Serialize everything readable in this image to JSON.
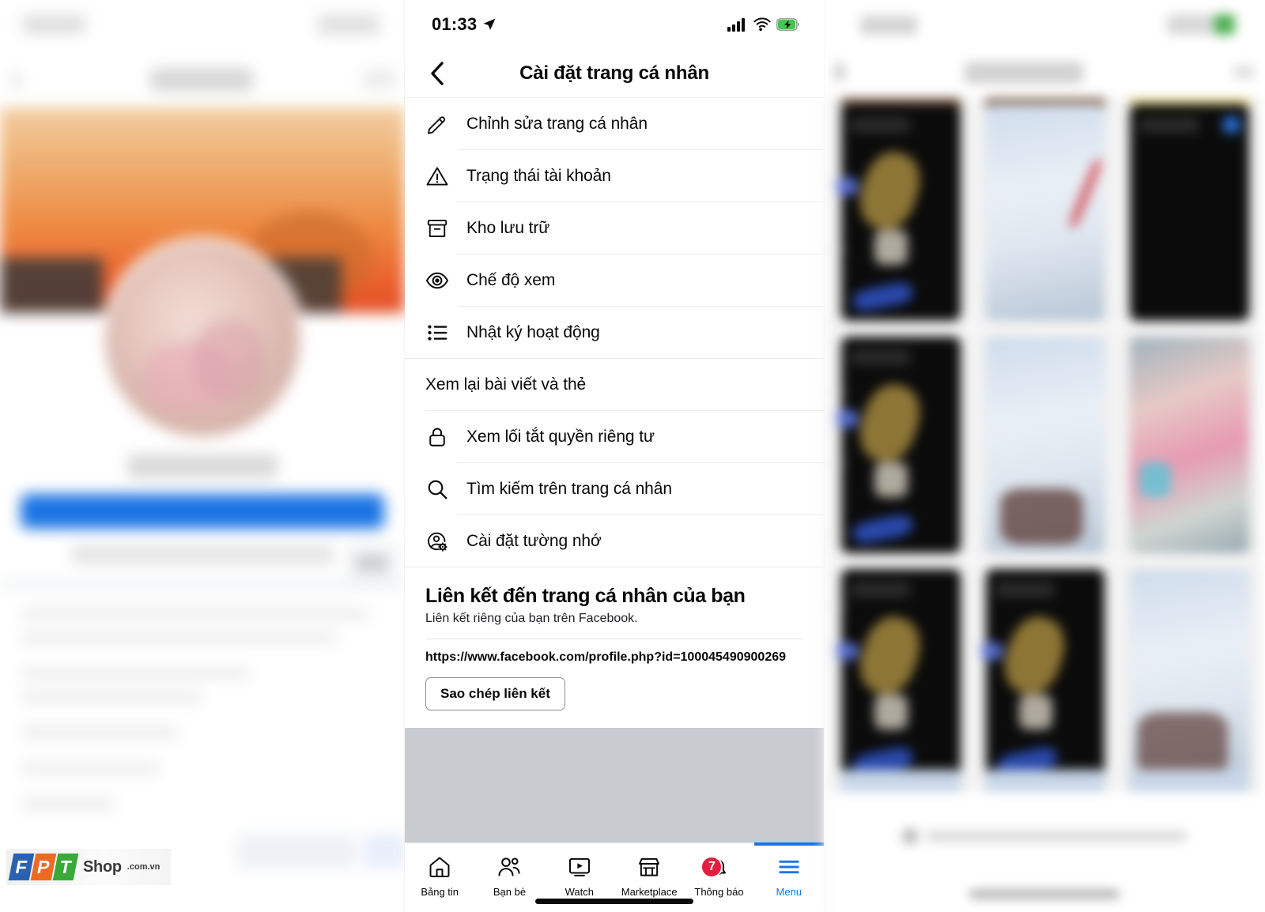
{
  "center": {
    "status_bar": {
      "time": "01:33",
      "location_icon": "location-arrow-icon",
      "signal_icon": "cellular-signal-icon",
      "wifi_icon": "wifi-icon",
      "battery_icon": "battery-charging-icon"
    },
    "nav": {
      "back_icon": "chevron-left-icon",
      "title": "Cài đặt trang cá nhân"
    },
    "menu_items": [
      {
        "label": "Chỉnh sửa trang cá nhân",
        "icon": "pencil-icon"
      },
      {
        "label": "Trạng thái tài khoản",
        "icon": "warning-triangle-icon"
      },
      {
        "label": "Kho lưu trữ",
        "icon": "archive-box-icon"
      },
      {
        "label": "Chế độ xem",
        "icon": "eye-icon"
      },
      {
        "label": "Nhật ký hoạt động",
        "icon": "bulleted-list-icon"
      },
      {
        "label": "Xem lại bài viết và thẻ",
        "icon": ""
      },
      {
        "label": "Xem lối tắt quyền riêng tư",
        "icon": "lock-icon"
      },
      {
        "label": "Tìm kiếm trên trang cá nhân",
        "icon": "search-icon"
      },
      {
        "label": "Cài đặt tường nhớ",
        "icon": "person-gear-icon"
      }
    ],
    "link_section": {
      "title": "Liên kết đến trang cá nhân của bạn",
      "subtitle": "Liên kết riêng của bạn trên Facebook.",
      "url": "https://www.facebook.com/profile.php?id=100045490900269",
      "copy_button": "Sao chép liên kết"
    },
    "tabs": [
      {
        "label": "Bảng tin",
        "icon": "home-icon",
        "active": false,
        "badge": ""
      },
      {
        "label": "Bạn bè",
        "icon": "friends-icon",
        "active": false,
        "badge": ""
      },
      {
        "label": "Watch",
        "icon": "watch-play-icon",
        "active": false,
        "badge": ""
      },
      {
        "label": "Marketplace",
        "icon": "marketplace-store-icon",
        "active": false,
        "badge": ""
      },
      {
        "label": "Thông báo",
        "icon": "bell-icon",
        "active": false,
        "badge": "7"
      },
      {
        "label": "Menu",
        "icon": "hamburger-menu-icon",
        "active": true,
        "badge": ""
      }
    ],
    "colors": {
      "accent": "#1b74e4",
      "badge": "#e41e3f",
      "text": "#080809",
      "divider": "#eaecef",
      "placeholder_block": "#c8cbd0"
    }
  },
  "left": {
    "watermark": {
      "mark_f": "F",
      "mark_p": "P",
      "mark_t": "T",
      "shop": "Shop",
      "domain": ".com.vn"
    },
    "more_button_icon": "ellipsis-icon",
    "primary_button_color": "#1b74e4",
    "cover_color": "#ee8a43"
  },
  "right": {
    "grid_cells": [
      {
        "kind": "dark"
      },
      {
        "kind": "sky"
      },
      {
        "kind": "dark"
      },
      {
        "kind": "dark"
      },
      {
        "kind": "sky"
      },
      {
        "kind": "photo"
      },
      {
        "kind": "dark"
      },
      {
        "kind": "dark"
      },
      {
        "kind": "sky"
      }
    ]
  }
}
